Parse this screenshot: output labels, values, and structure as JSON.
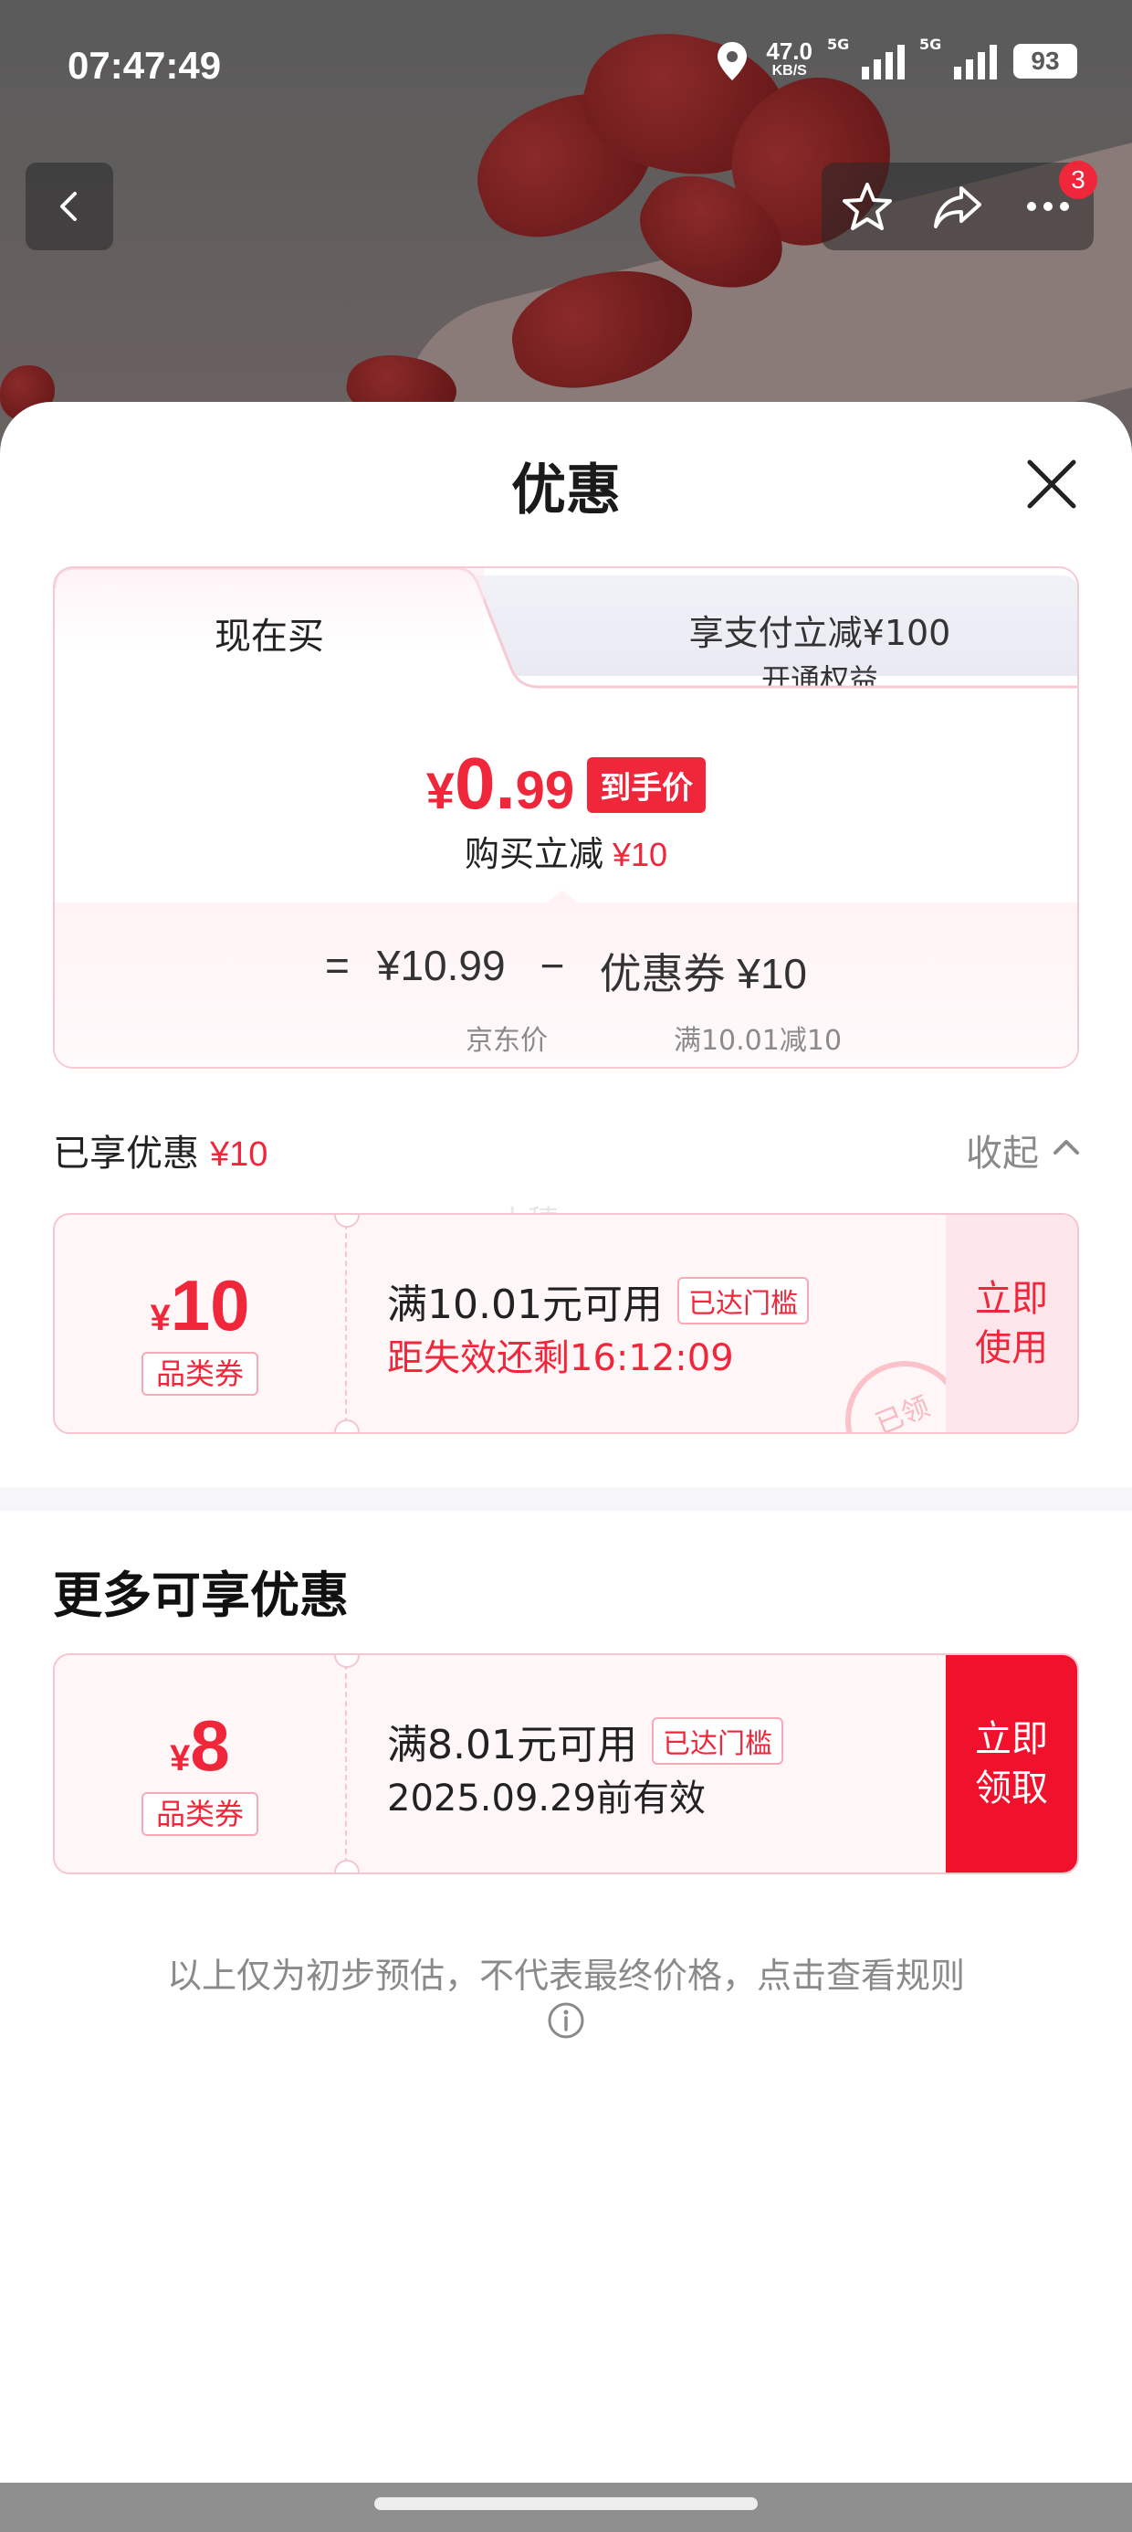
{
  "status_bar": {
    "time": "07:47:49",
    "speed_value": "47.0",
    "speed_unit": "KB/S",
    "signal1_label": "5G",
    "signal2_label": "5G",
    "battery": "93"
  },
  "header_actions": {
    "badge_count": "3"
  },
  "sheet": {
    "title": "优惠"
  },
  "price_card": {
    "tab_now": "现在买",
    "tab_other_main": "享支付立减¥100",
    "tab_other_sub": "开通权益",
    "final_price_yen": "¥",
    "final_price_int": "0.",
    "final_price_dec": "99",
    "final_price_tag": "到手价",
    "reduce_label": "购买立减",
    "reduce_value": "¥10",
    "formula_eq": "=",
    "formula_price": "¥10.99",
    "formula_minus": "−",
    "formula_coupon": "优惠券 ¥10",
    "label_price": "京东价",
    "label_coupon": "满10.01减10"
  },
  "enjoyed": {
    "title": "已享优惠",
    "amount": "¥10",
    "collapse": "收起",
    "watermark": "小穗"
  },
  "coupons": [
    {
      "yen": "¥",
      "amount": "10",
      "type": "品类券",
      "title": "满10.01元可用",
      "chip": "已达门槛",
      "sub": "距失效还剩16:12:09",
      "action": "立即\n使用",
      "stamp": "已领"
    },
    {
      "yen": "¥",
      "amount": "8",
      "type": "品类券",
      "title": "满8.01元可用",
      "chip": "已达门槛",
      "sub": "2025.09.29前有效",
      "action": "立即\n领取"
    }
  ],
  "more": {
    "title": "更多可享优惠"
  },
  "footer": {
    "note": "以上仅为初步预估，不代表最终价格，点击查看规则"
  },
  "colors": {
    "accent_red": "#f0263a",
    "coupon_border": "#f5c6cf",
    "muted_text": "#8a8a8a"
  },
  "icons": [
    "back-icon",
    "star-icon",
    "share-icon",
    "more-icon",
    "close-icon",
    "chevron-up-icon",
    "info-icon",
    "location-icon"
  ]
}
